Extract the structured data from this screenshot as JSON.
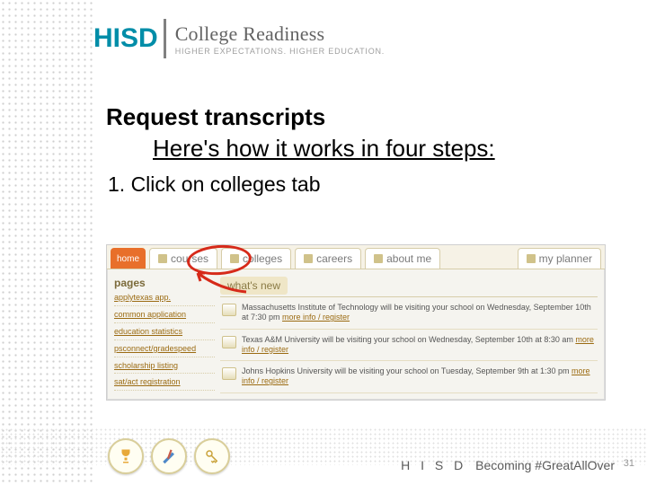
{
  "logo": {
    "hisd": "HISD",
    "college_readiness": "College Readiness",
    "tagline": "HIGHER EXPECTATIONS. HIGHER EDUCATION."
  },
  "title": "Request transcripts",
  "subtitle": "Here's how it works in four steps:",
  "step1": "1.   Click on colleges tab",
  "screenshot": {
    "tabs": {
      "home": "home",
      "courses": "courses",
      "colleges": "colleges",
      "careers": "careers",
      "about_me": "about me",
      "my_planner": "my planner"
    },
    "pages_heading": "pages",
    "page_links": [
      "applytexas app.",
      "common application",
      "education statistics",
      "psconnect/gradespeed",
      "scholarship listing",
      "sat/act registration"
    ],
    "whats_new": "what's new",
    "news": [
      {
        "text": "Massachusetts Institute of Technology will be visiting your school on Wednesday, September 10th at 7:30 pm ",
        "link": "more info / register"
      },
      {
        "text": "Texas A&M University will be visiting your school on Wednesday, September 10th at 8:30 am ",
        "link": "more info / register"
      },
      {
        "text": "Johns Hopkins University will be visiting your school on Tuesday, September 9th at 1:30 pm ",
        "link": "more info / register"
      }
    ]
  },
  "footer": {
    "hisd": "H I S D",
    "tag": "Becoming #GreatAllOver"
  },
  "page_number": "31"
}
